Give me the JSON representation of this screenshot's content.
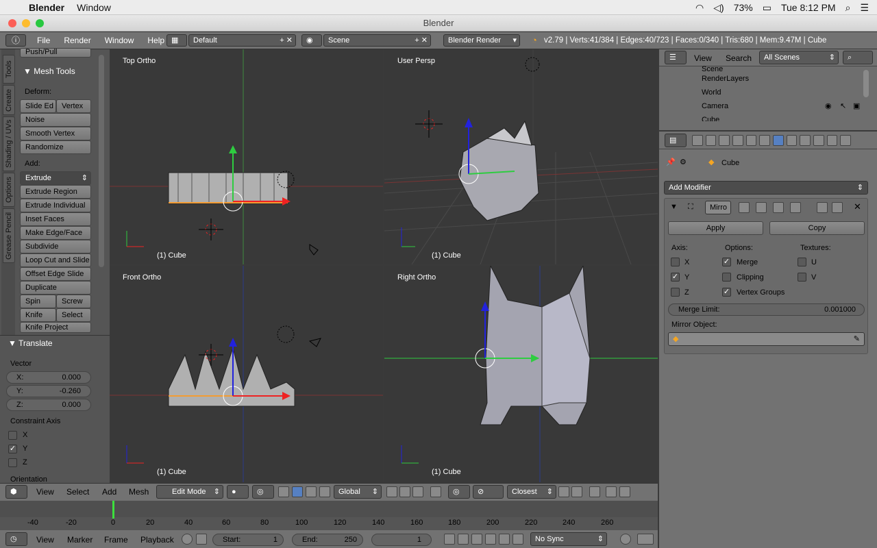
{
  "mac": {
    "app": "Blender",
    "menu_window": "Window",
    "battery": "73%",
    "clock": "Tue 8:12 PM"
  },
  "window": {
    "title": "Blender"
  },
  "info": {
    "menus": [
      "File",
      "Render",
      "Window",
      "Help"
    ],
    "layout": "Default",
    "scene": "Scene",
    "engine": "Blender Render",
    "stats": "v2.79 | Verts:41/384 | Edges:40/723 | Faces:0/340 | Tris:680 | Mem:9.47M | Cube"
  },
  "tools": {
    "tabs": [
      "Tools",
      "Create",
      "Shading / UVs",
      "Options",
      "Grease Pencil"
    ],
    "top_item": "Push/Pull",
    "mesh_tools_title": "Mesh Tools",
    "deform_label": "Deform:",
    "slide_edge": "Slide Ed",
    "vertex": "Vertex",
    "noise": "Noise",
    "smooth_vertex": "Smooth Vertex",
    "randomize": "Randomize",
    "add_label": "Add:",
    "extrude": "Extrude",
    "extrude_region": "Extrude Region",
    "extrude_individual": "Extrude Individual",
    "inset_faces": "Inset Faces",
    "make_edge_face": "Make Edge/Face",
    "subdivide": "Subdivide",
    "loop_cut": "Loop Cut and Slide",
    "offset_edge": "Offset Edge Slide",
    "duplicate": "Duplicate",
    "spin": "Spin",
    "screw": "Screw",
    "knife": "Knife",
    "select": "Select",
    "knife_project": "Knife Project"
  },
  "translate": {
    "title": "Translate",
    "vector_label": "Vector",
    "x_label": "X:",
    "x_val": "0.000",
    "y_label": "Y:",
    "y_val": "-0.260",
    "z_label": "Z:",
    "z_val": "0.000",
    "constraint_label": "Constraint Axis",
    "cx": "X",
    "cy": "Y",
    "cz": "Z",
    "orientation": "Orientation"
  },
  "viewports": {
    "top": "Top Ortho",
    "persp": "User Persp",
    "front": "Front Ortho",
    "right": "Right Ortho",
    "foot": "(1) Cube"
  },
  "outliner": {
    "view": "View",
    "search": "Search",
    "filter": "All Scenes",
    "items": [
      "Scene",
      "RenderLayers",
      "World",
      "Camera",
      "Cube"
    ]
  },
  "properties": {
    "context": "Cube",
    "add_modifier": "Add Modifier",
    "mod_name": "Mirro",
    "apply": "Apply",
    "copy": "Copy",
    "axis_label": "Axis:",
    "options_label": "Options:",
    "textures_label": "Textures:",
    "ax": "X",
    "ay": "Y",
    "az": "Z",
    "merge": "Merge",
    "clipping": "Clipping",
    "vgroups": "Vertex Groups",
    "tu": "U",
    "tv": "V",
    "merge_limit_label": "Merge Limit:",
    "merge_limit_val": "0.001000",
    "mirror_object_label": "Mirror Object:"
  },
  "header3d": {
    "view": "View",
    "select": "Select",
    "add": "Add",
    "mesh": "Mesh",
    "mode": "Edit Mode",
    "orientation": "Global",
    "snap": "Closest"
  },
  "timeline": {
    "ticks": [
      "-40",
      "-20",
      "0",
      "20",
      "40",
      "60",
      "80",
      "100",
      "120",
      "140",
      "160",
      "180",
      "200",
      "220",
      "240",
      "260"
    ],
    "view": "View",
    "marker": "Marker",
    "frame": "Frame",
    "playback": "Playback",
    "start_label": "Start:",
    "start": "1",
    "end_label": "End:",
    "end": "250",
    "current": "1",
    "sync": "No Sync"
  }
}
